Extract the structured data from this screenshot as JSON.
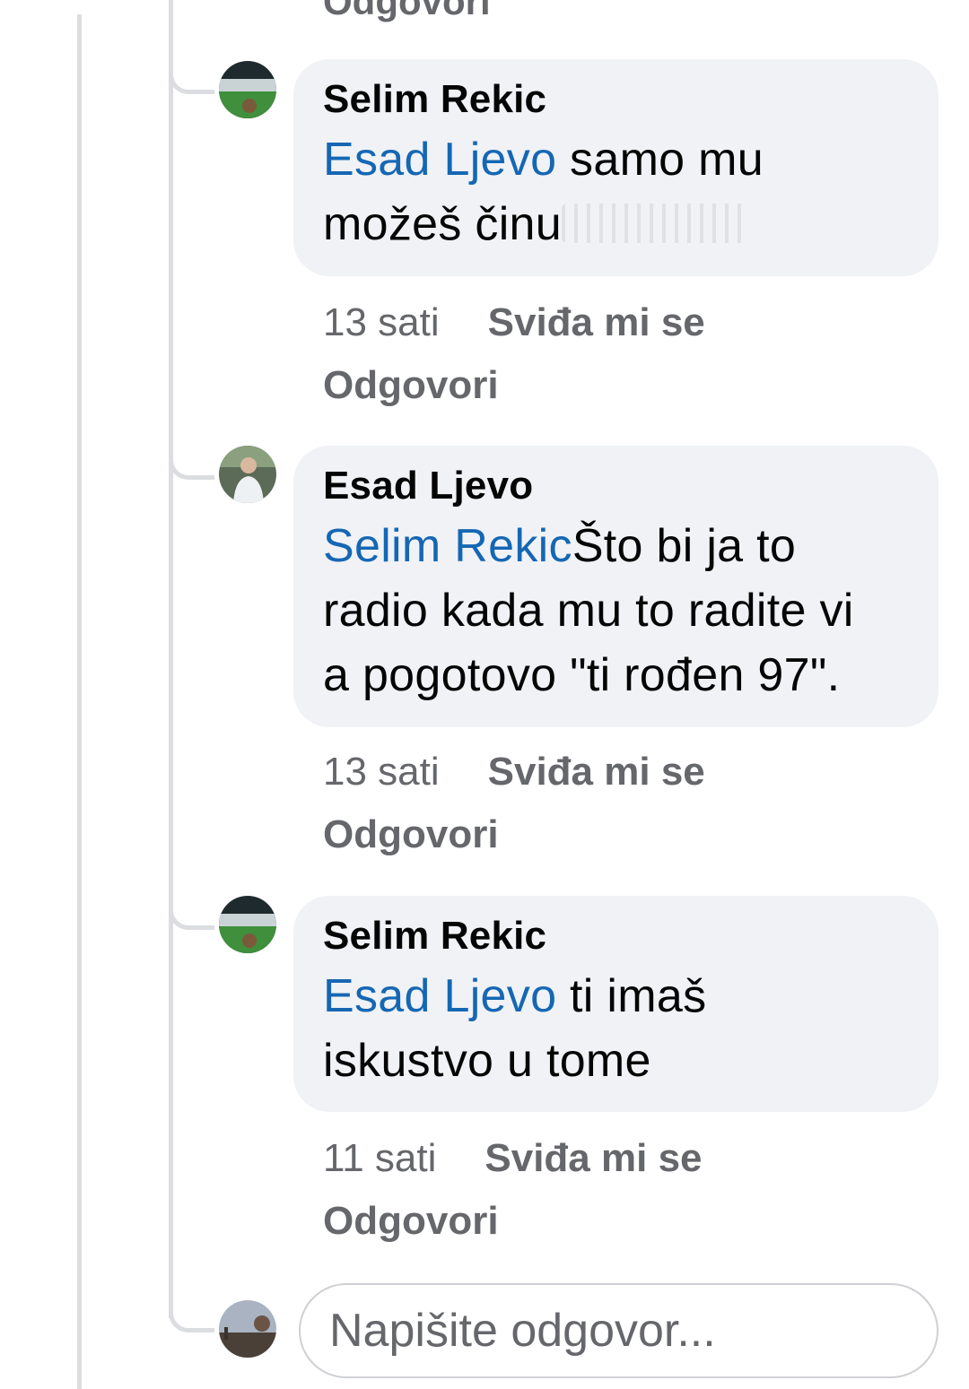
{
  "previous_reply_label": "Odgovori",
  "comments": [
    {
      "author": "Selim Rekic",
      "mention": "Esad Ljevo",
      "text_line1": " samo mu",
      "text_line2": "možeš činu",
      "time": "13 sati",
      "like_label": "Sviđa mi se",
      "reply_label": "Odgovori"
    },
    {
      "author": "Esad Ljevo",
      "mention": "Selim Rekic",
      "text_line1": "Što bi ja to",
      "text_line2": "radio kada mu to radite vi",
      "text_line3": "a pogotovo \"ti rođen 97\".",
      "time": "13 sati",
      "like_label": "Sviđa mi se",
      "reply_label": "Odgovori"
    },
    {
      "author": "Selim Rekic",
      "mention": "Esad Ljevo",
      "text_line1": " ti imaš",
      "text_line2": "iskustvo u tome",
      "time": "11 sati",
      "like_label": "Sviđa mi se",
      "reply_label": "Odgovori"
    }
  ],
  "reply_box": {
    "placeholder": "Napišite odgovor..."
  },
  "colors": {
    "mention": "#1567b4",
    "bubble": "#f0f2f5",
    "meta_text": "#65676b",
    "thread_line": "#dcdde0"
  }
}
